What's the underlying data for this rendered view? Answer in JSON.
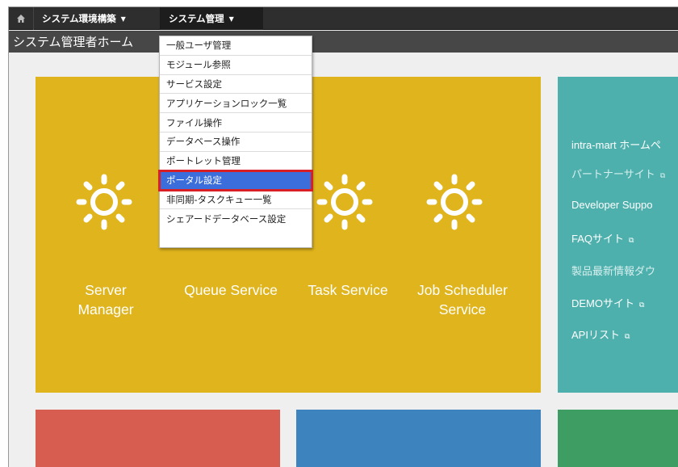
{
  "topnav": {
    "home_icon": "home-icon",
    "items": [
      {
        "label": "システム環境構築",
        "caret": "▼"
      },
      {
        "label": "システム管理",
        "caret": "▼"
      }
    ]
  },
  "page_title": "システム管理者ホーム",
  "dropdown": {
    "items": [
      "一般ユーザ管理",
      "モジュール参照",
      "サービス設定",
      "アプリケーションロック一覧",
      "ファイル操作",
      "データベース操作",
      "ポートレット管理",
      "ポータル設定",
      "非同期-タスクキュー一覧",
      "シェアードデータベース設定"
    ],
    "highlighted": "ポータル設定"
  },
  "services": [
    {
      "label": "Server Manager",
      "icon": "sun-icon"
    },
    {
      "label": "Queue Service",
      "icon": "sun-icon"
    },
    {
      "label": "Task Service",
      "icon": "sun-icon"
    },
    {
      "label": "Job Scheduler Service",
      "icon": "sun-icon"
    }
  ],
  "links": [
    {
      "label": "intra-mart ホームペ"
    },
    {
      "label": "パートナーサイト"
    },
    {
      "label": "Developer Suppo"
    },
    {
      "label": "FAQサイト"
    },
    {
      "label": "製品最新情報ダウ"
    },
    {
      "label": "DEMOサイト"
    },
    {
      "label": "APIリスト"
    }
  ],
  "colors": {
    "yellow_tile": "#dfb41c",
    "teal_tile": "#4eb0ad",
    "red_tile": "#d65d4f",
    "blue_tile": "#3d83bd",
    "green_tile": "#3e9d62",
    "highlight": "#3c6edb",
    "highlight_border": "#d81f26"
  }
}
